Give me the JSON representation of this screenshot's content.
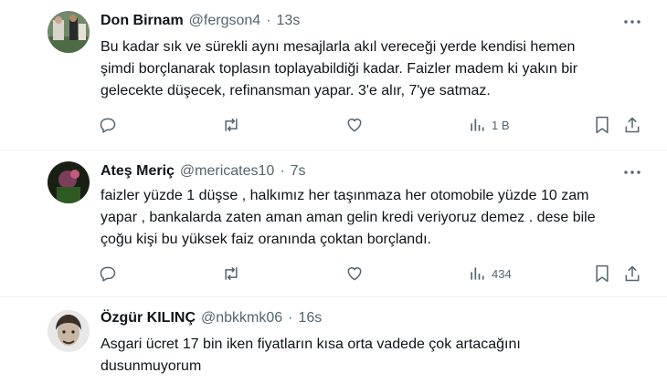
{
  "tweets": [
    {
      "name": "Don Birnam",
      "handle": "@fergson4",
      "separator": "·",
      "time": "13s",
      "text_lines": [
        "Bu kadar sık ve sürekli aynı mesajlarla akıl vereceği yerde kendisi hemen",
        "şimdi borçlanarak toplasın toplayabildiği kadar. Faizler madem ki yakın bir",
        "gelecekte düşecek, refinansman yapar. 3'e alır, 7'ye satmaz."
      ],
      "views": "1 B",
      "icons": [
        "reply-icon",
        "retweet-icon",
        "like-icon",
        "views-icon",
        "bookmark-icon",
        "share-icon"
      ]
    },
    {
      "name": "Ateş Meriç",
      "handle": "@mericates10",
      "separator": "·",
      "time": "7s",
      "text_lines": [
        "faizler yüzde 1 düşse , halkımız her taşınmaza her otomobile yüzde 10 zam",
        "yapar , bankalarda zaten aman aman gelin kredi veriyoruz demez . dese bile",
        "çoğu kişi bu yüksek faiz oranında çoktan borçlandı."
      ],
      "views": "434",
      "icons": [
        "reply-icon",
        "retweet-icon",
        "like-icon",
        "views-icon",
        "bookmark-icon",
        "share-icon"
      ]
    },
    {
      "name": "Özgür KILINÇ",
      "handle": "@nbkkmk06",
      "separator": "·",
      "time": "16s",
      "text_lines": [
        "Asgari ücret 17 bin iken fiyatların kısa orta vadede çok artacağını",
        "dusunmuyorum"
      ]
    }
  ],
  "colors": {
    "text": "#0f1419",
    "muted": "#536471",
    "divider": "#eff3f4"
  }
}
